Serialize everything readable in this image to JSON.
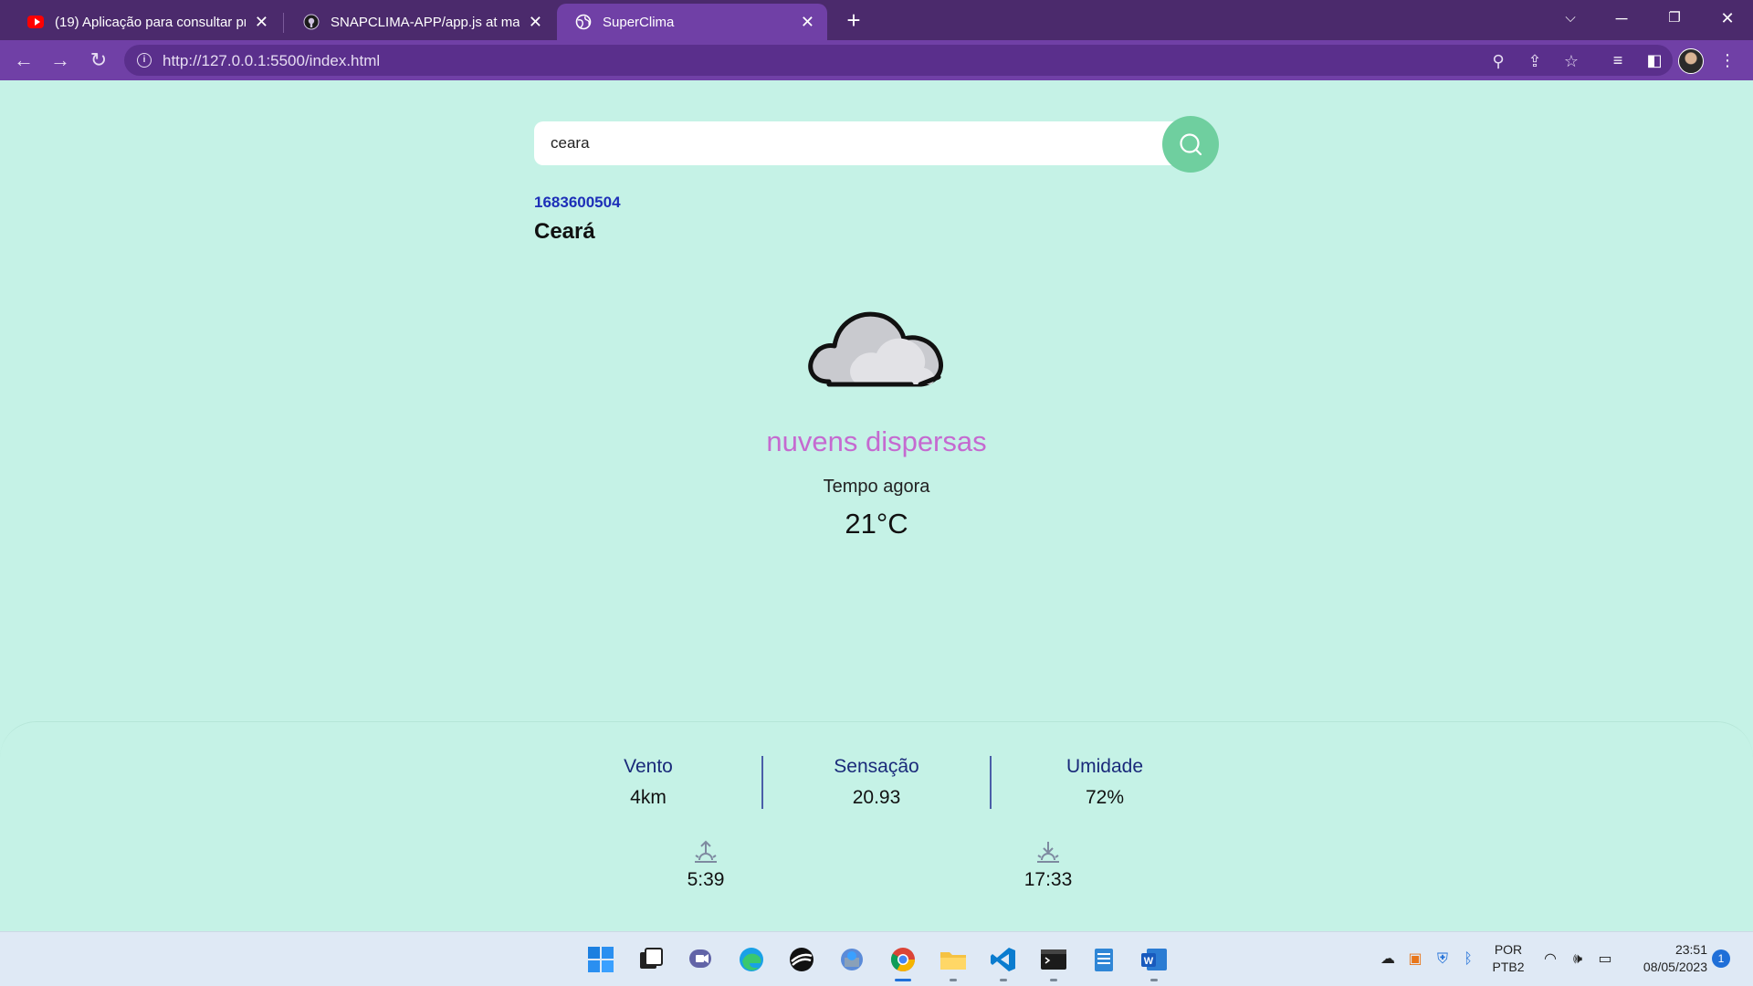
{
  "browser": {
    "tabs": [
      {
        "title": "(19) Aplicação para consultar pre",
        "icon": "youtube-icon"
      },
      {
        "title": "SNAPCLIMA-APP/app.js at main",
        "icon": "github-icon"
      },
      {
        "title": "SuperClima",
        "icon": "globe-icon",
        "active": true
      }
    ],
    "url": "http://127.0.0.1:5500/index.html"
  },
  "search": {
    "value": "ceara",
    "placeholder": ""
  },
  "location": {
    "timestamp": "1683600504",
    "city": "Ceará"
  },
  "weather": {
    "icon": "cloud-icon",
    "description": "nuvens dispersas",
    "label": "Tempo agora",
    "temperature": "21°C"
  },
  "details": {
    "wind": {
      "label": "Vento",
      "value": "4km"
    },
    "feels_like": {
      "label": "Sensação",
      "value": "20.93"
    },
    "humidity": {
      "label": "Umidade",
      "value": "72%"
    }
  },
  "sun": {
    "sunrise": "5:39",
    "sunset": "17:33"
  },
  "taskbar": {
    "language": "POR",
    "layout": "PTB2",
    "time": "23:51",
    "date": "08/05/2023",
    "notifications": "1"
  },
  "colors": {
    "page_background": "#c5f2e6",
    "search_button": "#6fcf9f",
    "description": "#c56ad0",
    "timestamp": "#1d2fb8",
    "browser_chrome": "#7040a6"
  }
}
